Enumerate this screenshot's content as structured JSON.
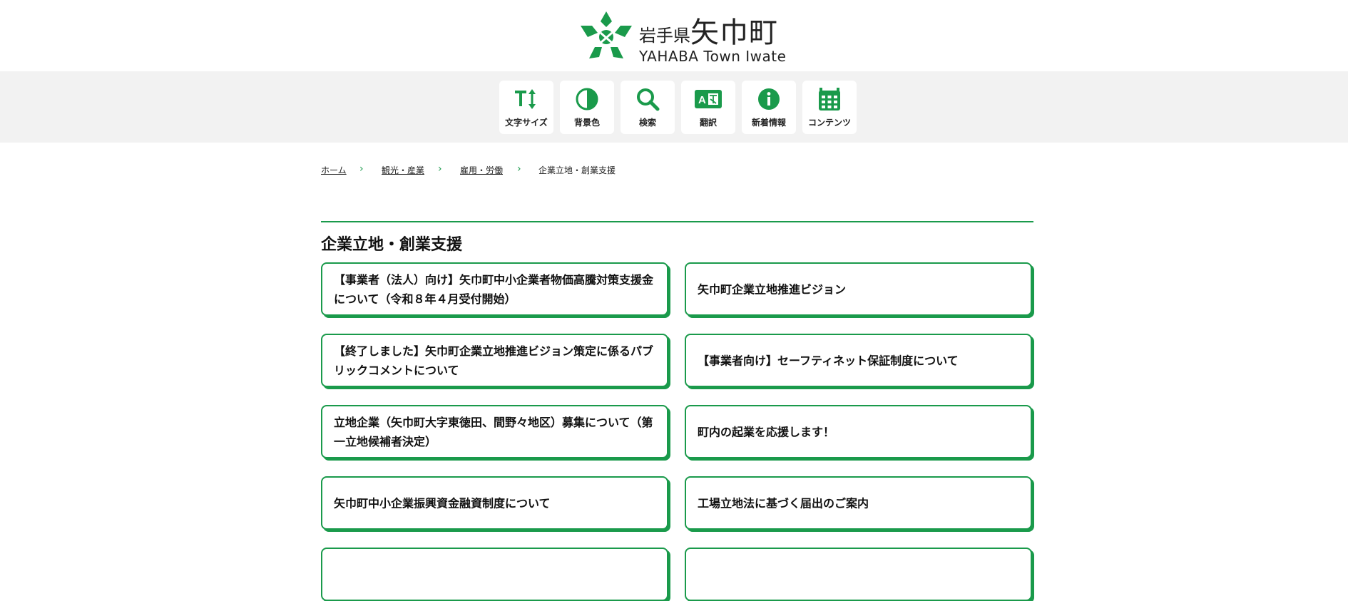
{
  "header": {
    "logo_pref": "岩手県",
    "logo_town": "矢巾町",
    "logo_en": "YAHABA Town Iwate"
  },
  "toolbar": [
    {
      "label": "文字サイズ",
      "icon": "text-size-icon"
    },
    {
      "label": "背景色",
      "icon": "contrast-icon"
    },
    {
      "label": "検索",
      "icon": "search-icon"
    },
    {
      "label": "翻訳",
      "icon": "translate-icon"
    },
    {
      "label": "新着情報",
      "icon": "info-icon"
    },
    {
      "label": "コンテンツ",
      "icon": "calendar-grid-icon"
    }
  ],
  "breadcrumb": [
    {
      "label": "ホーム"
    },
    {
      "label": "観光・産業"
    },
    {
      "label": "雇用・労働"
    },
    {
      "label": "企業立地・創業支援"
    }
  ],
  "page_title": "企業立地・創業支援",
  "cards": [
    {
      "title": "【事業者（法人）向け】矢巾町中小企業者物価高騰対策支援金について（令和８年４月受付開始）"
    },
    {
      "title": "矢巾町企業立地推進ビジョン"
    },
    {
      "title": "【終了しました】矢巾町企業立地推進ビジョン策定に係るパブリックコメントについて"
    },
    {
      "title": "【事業者向け】セーフティネット保証制度について"
    },
    {
      "title": "立地企業（矢巾町大字東徳田、間野々地区）募集について（第一立地候補者決定）"
    },
    {
      "title": "町内の起業を応援します！"
    },
    {
      "title": "矢巾町中小企業振興資金融資制度について"
    },
    {
      "title": "工場立地法に基づく届出のご案内"
    },
    {
      "title": ""
    },
    {
      "title": ""
    }
  ],
  "colors": {
    "accent": "#1a9a4b",
    "toolbar_bg": "#f2f2f2"
  }
}
